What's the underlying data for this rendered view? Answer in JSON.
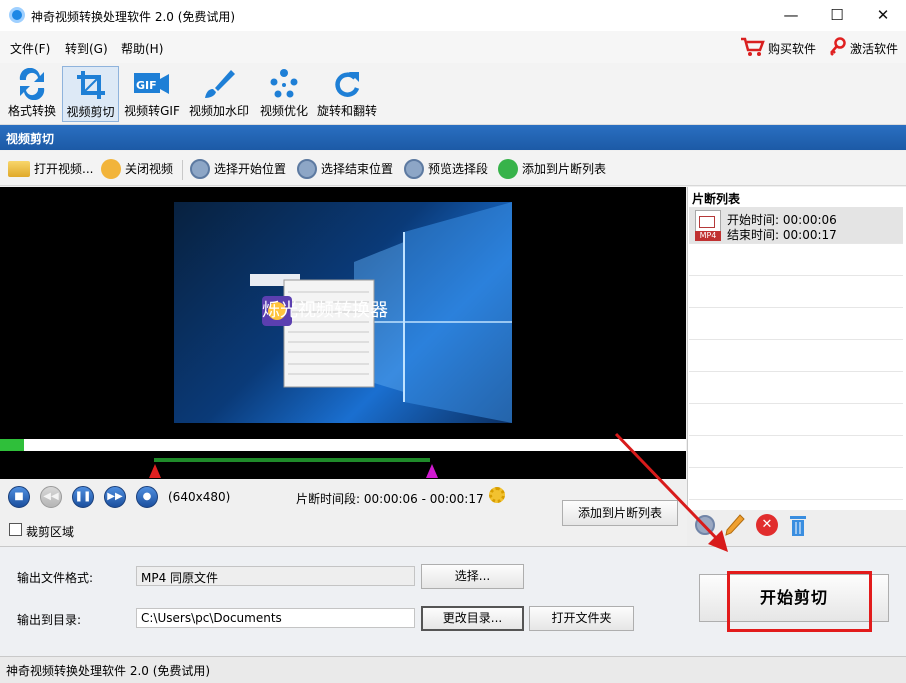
{
  "window": {
    "title": "神奇视频转换处理软件 2.0 (免费试用)",
    "controls": {
      "minimize": "—",
      "maximize": "☐",
      "close": "✕"
    }
  },
  "menu": {
    "items": [
      "文件(F)",
      "转到(G)",
      "帮助(H)"
    ],
    "buy_label": "购买软件",
    "activate_label": "激活软件"
  },
  "toolbar": {
    "items": [
      {
        "label": "格式转换",
        "icon": "format-convert-icon"
      },
      {
        "label": "视频剪切",
        "icon": "crop-icon",
        "active": true
      },
      {
        "label": "视频转GIF",
        "icon": "gif-icon"
      },
      {
        "label": "视频加水印",
        "icon": "brush-icon"
      },
      {
        "label": "视频优化",
        "icon": "optimize-icon"
      },
      {
        "label": "旋转和翻转",
        "icon": "rotate-icon"
      }
    ],
    "gif_badge": "GIF"
  },
  "section": {
    "title": "视频剪切"
  },
  "actions": {
    "open_video": "打开视频...",
    "close_video": "关闭视频",
    "select_start": "选择开始位置",
    "select_end": "选择结束位置",
    "preview_segment": "预览选择段",
    "add_to_list": "添加到片断列表"
  },
  "preview": {
    "watermark_text": "烁光视频转换器",
    "progress_fraction": 0.035
  },
  "playback": {
    "resolution": "(640x480)",
    "segment_label": "片断时间段:",
    "segment_value": "00:00:06 - 00:00:17",
    "add_button": "添加到片断列表",
    "crop_label": "裁剪区域",
    "crop_checked": false
  },
  "clip_list": {
    "title": "片断列表",
    "items": [
      {
        "badge": "MP4",
        "start_label": "开始时间:",
        "start": "00:00:06",
        "end_label": "结束时间:",
        "end": "00:00:17"
      }
    ]
  },
  "output": {
    "format_label": "输出文件格式:",
    "format_value": "MP4 同原文件",
    "select_button": "选择...",
    "dir_label": "输出到目录:",
    "dir_value": "C:\\Users\\pc\\Documents",
    "change_dir_button": "更改目录...",
    "open_folder_button": "打开文件夹",
    "start_button": "开始剪切"
  },
  "status_bar": {
    "text": "神奇视频转换处理软件 2.0 (免费试用)"
  },
  "colors": {
    "accent": "#1c5aa6",
    "highlight": "#e21b1b",
    "progress": "#2fbf3a"
  }
}
